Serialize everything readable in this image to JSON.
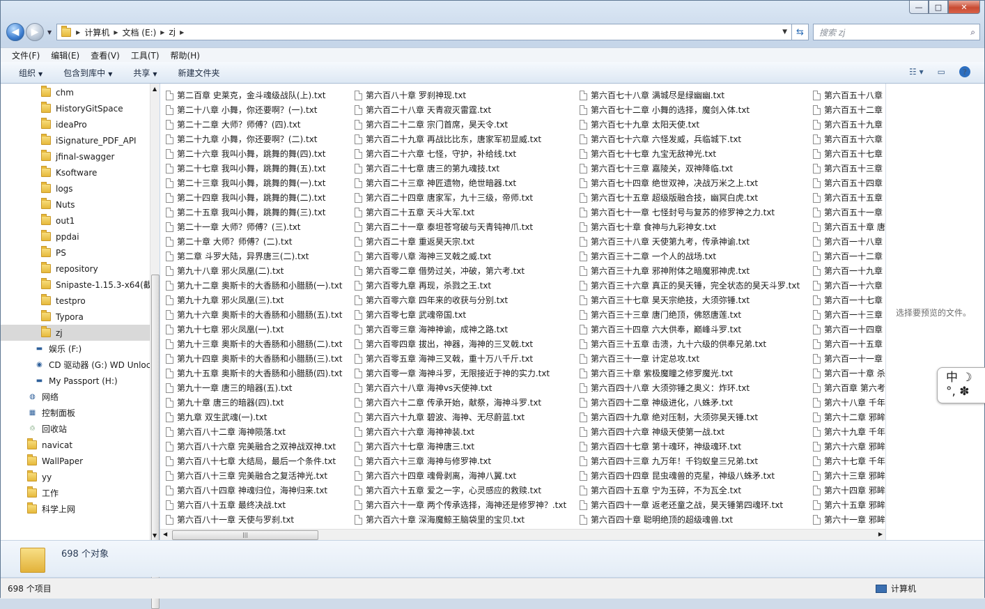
{
  "window": {
    "min": "—",
    "max": "□",
    "close": "✕"
  },
  "address": {
    "crumbs": [
      "计算机",
      "文档 (E:)",
      "zj"
    ],
    "search_placeholder": "搜索 zj"
  },
  "menu": [
    "文件(F)",
    "编辑(E)",
    "查看(V)",
    "工具(T)",
    "帮助(H)"
  ],
  "commands": [
    "组织",
    "包含到库中",
    "共享",
    "新建文件夹"
  ],
  "nav": [
    {
      "label": "chm",
      "icon": "folder"
    },
    {
      "label": "HistoryGitSpace",
      "icon": "folder"
    },
    {
      "label": "ideaPro",
      "icon": "folder"
    },
    {
      "label": "iSignature_PDF_API",
      "icon": "folder"
    },
    {
      "label": "jfinal-swagger",
      "icon": "folder"
    },
    {
      "label": "Ksoftware",
      "icon": "folder"
    },
    {
      "label": "logs",
      "icon": "folder"
    },
    {
      "label": "Nuts",
      "icon": "folder"
    },
    {
      "label": "out1",
      "icon": "folder"
    },
    {
      "label": "ppdai",
      "icon": "folder"
    },
    {
      "label": "PS",
      "icon": "folder"
    },
    {
      "label": "repository",
      "icon": "folder"
    },
    {
      "label": "Snipaste-1.15.3-x64(截",
      "icon": "folder"
    },
    {
      "label": "testpro",
      "icon": "folder"
    },
    {
      "label": "Typora",
      "icon": "folder"
    },
    {
      "label": "zj",
      "icon": "folder",
      "selected": true
    },
    {
      "label": "娱乐 (F:)",
      "icon": "drive"
    },
    {
      "label": "CD 驱动器 (G:) WD Unloc",
      "icon": "cd"
    },
    {
      "label": "My Passport (H:)",
      "icon": "drive"
    },
    {
      "label": "网络",
      "icon": "network"
    },
    {
      "label": "控制面板",
      "icon": "control"
    },
    {
      "label": "回收站",
      "icon": "recycle"
    },
    {
      "label": "navicat",
      "icon": "folder"
    },
    {
      "label": "WallPaper",
      "icon": "folder"
    },
    {
      "label": "yy",
      "icon": "folder"
    },
    {
      "label": "工作",
      "icon": "folder"
    },
    {
      "label": "科学上网",
      "icon": "folder"
    }
  ],
  "files": [
    [
      "第二百章 史莱克，金斗魂级战队(上).txt",
      "第二十八章 小舞，你还要啊？(一).txt",
      "第二十二章 大师？师傅？(四).txt",
      "第二十九章 小舞，你还要啊？(二).txt",
      "第二十六章 我叫小舞，跳舞的舞(四).txt",
      "第二十七章 我叫小舞，跳舞的舞(五).txt",
      "第二十三章 我叫小舞，跳舞的舞(一).txt",
      "第二十四章 我叫小舞，跳舞的舞(二).txt",
      "第二十五章 我叫小舞，跳舞的舞(三).txt",
      "第二十一章 大师？师傅？(三).txt",
      "第二十章 大师？师傅？(二).txt",
      "第二章 斗罗大陆，异界唐三(二).txt",
      "第九十八章 邪火凤凰(二).txt",
      "第九十二章 奥斯卡的大香肠和小腊肠(一).txt",
      "第九十九章 邪火凤凰(三).txt",
      "第九十六章 奥斯卡的大香肠和小腊肠(五).txt",
      "第九十七章 邪火凤凰(一).txt",
      "第九十三章 奥斯卡的大香肠和小腊肠(二).txt",
      "第九十四章 奥斯卡的大香肠和小腊肠(三).txt",
      "第九十五章 奥斯卡的大香肠和小腊肠(四).txt",
      "第九十一章 唐三的暗器(五).txt",
      "第九十章 唐三的暗器(四).txt",
      "第九章 双生武魂(一).txt",
      "第六百八十二章 海神陨落.txt",
      "第六百八十六章 完美融合之双神战双神.txt",
      "第六百八十七章 大结局，最后一个条件.txt",
      "第六百八十三章 完美融合之复活神光.txt",
      "第六百八十四章 神魂归位，海神归来.txt",
      "第六百八十五章 最终决战.txt",
      "第六百八十一章 天使与罗刹.txt"
    ],
    [
      "第六百八十章 罗刹神现.txt",
      "第六百二十八章 天青寂灭雷霆.txt",
      "第六百二十二章 宗门首席，昊天令.txt",
      "第六百二十九章 再战比比东，唐家军初显威.txt",
      "第六百二十六章 七怪，守护，补给线.txt",
      "第六百二十七章 唐三的第九魂技.txt",
      "第六百二十三章 神匠遗物，绝世暗器.txt",
      "第六百二十四章 唐家军，九十三级，帝师.txt",
      "第六百二十五章 天斗大军.txt",
      "第六百二十一章 泰坦苍穹破与天青钝神爪.txt",
      "第六百二十章 重返昊天宗.txt",
      "第六百零八章 海神三叉戟之威.txt",
      "第六百零二章 借势过关，冲破，第六考.txt",
      "第六百零九章 再现，杀戮之王.txt",
      "第六百零六章 四年来的收获与分别.txt",
      "第六百零七章 武魂帝国.txt",
      "第六百零三章 海神神谕，成神之路.txt",
      "第六百零四章 拔出，神器，海神的三叉戟.txt",
      "第六百零五章 海神三叉戟，重十万八千斤.txt",
      "第六百零一章 海神斗罗，无限接近于神的实力.txt",
      "第六百六十八章 海神vs天使神.txt",
      "第六百六十二章 传承开始，献祭，海神斗罗.txt",
      "第六百六十九章 碧波、海神、无尽蔚蓝.txt",
      "第六百六十六章 海神神装.txt",
      "第六百六十七章 海神唐三.txt",
      "第六百六十三章 海神与修罗神.txt",
      "第六百六十四章 魂骨剥离，海神八翼.txt",
      "第六百六十五章 爱之一字，心灵感应的救赎.txt",
      "第六百六十一章 两个传承选择，海神还是修罗神？.txt",
      "第六百六十章 深海魔鲸王脑袋里的宝贝.txt"
    ],
    [
      "第六百七十八章 满城尽是绿幽幽.txt",
      "第六百七十二章 小舞的选择，魔剑入体.txt",
      "第六百七十九章 太阳天使.txt",
      "第六百七十六章 六怪发威，兵临城下.txt",
      "第六百七十七章 九宝无敌神光.txt",
      "第六百七十三章 嘉陵关，双神降临.txt",
      "第六百七十四章 绝世双神，决战万米之上.txt",
      "第六百七十五章 超级版融合技，幽冥白虎.txt",
      "第六百七十一章 七怪封号与复苏的修罗神之力.txt",
      "第六百七十章 食神与九彩神女.txt",
      "第六百三十八章 天使第九考，传承神谕.txt",
      "第六百三十二章 一个人的战场.txt",
      "第六百三十九章 邪神附体之暗魔邪神虎.txt",
      "第六百三十六章 真正的昊天锤，完全状态的昊天斗罗.txt",
      "第六百三十七章 昊天宗绝技，大须弥锤.txt",
      "第六百三十三章 唐门绝顶，佛怒唐莲.txt",
      "第六百三十四章 六大供奉，巅峰斗罗.txt",
      "第六百三十五章 击溃，九十六级的供奉兄弟.txt",
      "第六百三十一章 计定总攻.txt",
      "第六百三十章 紫极魔瞳之修罗魔光.txt",
      "第六百四十八章 大须弥锤之奥义：炸环.txt",
      "第六百四十二章 神级进化，八蛛矛.txt",
      "第六百四十九章 绝对压制，大须弥昊天锤.txt",
      "第六百四十六章 神级天使第一战.txt",
      "第六百四十七章 第十魂环，神级魂环.txt",
      "第六百四十三章 九万年！千钧蚁皇三兄弟.txt",
      "第六百四十四章 昆虫魂兽的克星，神级八蛛矛.txt",
      "第六百四十五章 宁为玉碎，不为瓦全.txt",
      "第六百四十一章 返老还童之战，昊天锤第四魂环.txt",
      "第六百四十章 聪明绝顶的超级魂兽.txt"
    ],
    [
      "第六百五十八章",
      "第六百五十二章",
      "第六百五十九章",
      "第六百五十六章",
      "第六百五十七章",
      "第六百五十三章",
      "第六百五十四章",
      "第六百五十五章",
      "第六百五十一章",
      "第六百五十章 唐",
      "第六百一十八章",
      "第六百一十二章",
      "第六百一十九章",
      "第六百一十六章",
      "第六百一十七章",
      "第六百一十三章",
      "第六百一十四章",
      "第六百一十五章",
      "第六百一十一章",
      "第六百一十章 杀",
      "第六百章 第六考",
      "第六十八章 千年",
      "第六十二章 邪眸",
      "第六十九章 千年",
      "第六十六章 邪眸",
      "第六十七章 千年",
      "第六十三章 邪眸",
      "第六十四章 邪眸",
      "第六十五章 邪眸",
      "第六十一章 邪眸"
    ]
  ],
  "preview": {
    "message": "选择要预览的文件。"
  },
  "ime": {
    "line1": "中 ☽",
    "line2": "°, ✽"
  },
  "details": {
    "count": "698 个对象"
  },
  "status": {
    "items": "698 个项目",
    "location": "计算机"
  }
}
